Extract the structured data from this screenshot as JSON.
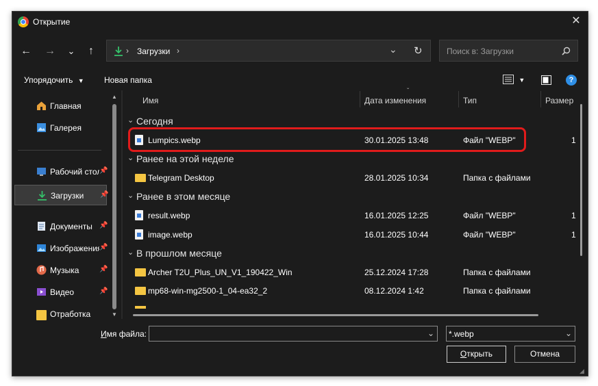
{
  "window": {
    "title": "Открытие"
  },
  "nav": {
    "back": "←",
    "forward": "→",
    "recent": "⌄",
    "up": "↑"
  },
  "address": {
    "crumb_sep": "›",
    "crumb": "Загрузки",
    "crumb_sep2": "›",
    "dropdown": "⌄",
    "refresh": "↻"
  },
  "search": {
    "placeholder": "Поиск в: Загрузки"
  },
  "toolbar": {
    "organize": "Упорядочить",
    "new_folder": "Новая папка",
    "help": "?"
  },
  "sidebar": {
    "items": [
      {
        "label": "Главная",
        "icon": "home-icon"
      },
      {
        "label": "Галерея",
        "icon": "gallery-icon"
      },
      {
        "label": "Рабочий стол",
        "icon": "desktop-icon",
        "pinned": true
      },
      {
        "label": "Загрузки",
        "icon": "download-icon",
        "pinned": true,
        "selected": true
      },
      {
        "label": "Документы",
        "icon": "documents-icon",
        "pinned": true
      },
      {
        "label": "Изображения",
        "icon": "pictures-icon",
        "pinned": true
      },
      {
        "label": "Музыка",
        "icon": "music-icon",
        "pinned": true
      },
      {
        "label": "Видео",
        "icon": "video-icon",
        "pinned": true
      },
      {
        "label": "Отработка",
        "icon": "folder-icon"
      }
    ]
  },
  "columns": {
    "name": "Имя",
    "date": "Дата изменения",
    "type": "Тип",
    "size": "Размер"
  },
  "groups": [
    {
      "label": "Сегодня",
      "rows": [
        {
          "name": "Lumpics.webp",
          "date": "30.01.2025 13:48",
          "type": "Файл \"WEBP\"",
          "size": "1",
          "kind": "file"
        }
      ]
    },
    {
      "label": "Ранее на этой неделе",
      "rows": [
        {
          "name": "Telegram Desktop",
          "date": "28.01.2025 10:34",
          "type": "Папка с файлами",
          "size": "",
          "kind": "folder"
        }
      ]
    },
    {
      "label": "Ранее в этом месяце",
      "rows": [
        {
          "name": "result.webp",
          "date": "16.01.2025 12:25",
          "type": "Файл \"WEBP\"",
          "size": "1",
          "kind": "file"
        },
        {
          "name": "image.webp",
          "date": "16.01.2025 10:44",
          "type": "Файл \"WEBP\"",
          "size": "1",
          "kind": "file"
        }
      ]
    },
    {
      "label": "В прошлом месяце",
      "rows": [
        {
          "name": "Archer T2U_Plus_UN_V1_190422_Win",
          "date": "25.12.2024 17:28",
          "type": "Папка с файлами",
          "size": "",
          "kind": "folder"
        },
        {
          "name": "mp68-win-mg2500-1_04-ea32_2",
          "date": "08.12.2024 1:42",
          "type": "Папка с файлами",
          "size": "",
          "kind": "folder"
        }
      ]
    }
  ],
  "bottom": {
    "filename_label_prefix": "",
    "filename_label_u": "И",
    "filename_label_rest": "мя файла:",
    "filename_value": "",
    "filetype_value": "*.webp",
    "open_u": "О",
    "open_rest": "ткрыть",
    "cancel": "Отмена"
  },
  "colors": {
    "highlight": "#e11b1b",
    "accent": "#4cc2ff"
  }
}
